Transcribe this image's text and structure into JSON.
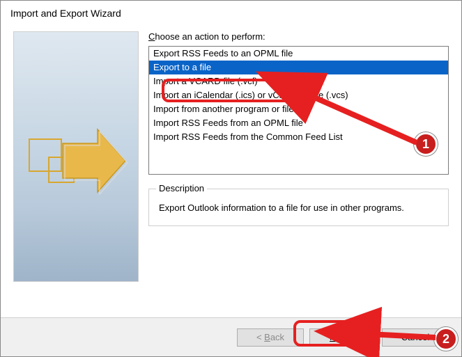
{
  "title": "Import and Export Wizard",
  "prompt_prefix": "C",
  "prompt_rest": "hoose an action to perform:",
  "list": {
    "items": [
      {
        "label": "Export RSS Feeds to an OPML file",
        "selected": false
      },
      {
        "label": "Export to a file",
        "selected": true
      },
      {
        "label": "Import a VCARD file (.vcf)",
        "selected": false
      },
      {
        "label": "Import an iCalendar (.ics) or vCalendar file (.vcs)",
        "selected": false
      },
      {
        "label": "Import from another program or file",
        "selected": false
      },
      {
        "label": "Import RSS Feeds from an OPML file",
        "selected": false
      },
      {
        "label": "Import RSS Feeds from the Common Feed List",
        "selected": false
      }
    ]
  },
  "description": {
    "legend": "Description",
    "text": "Export Outlook information to a file for use in other programs."
  },
  "buttons": {
    "back_prefix": "< ",
    "back_u": "B",
    "back_rest": "ack",
    "next_u": "N",
    "next_rest": "ext >",
    "cancel": "Cancel"
  },
  "annotations": {
    "badge1": "1",
    "badge2": "2"
  }
}
